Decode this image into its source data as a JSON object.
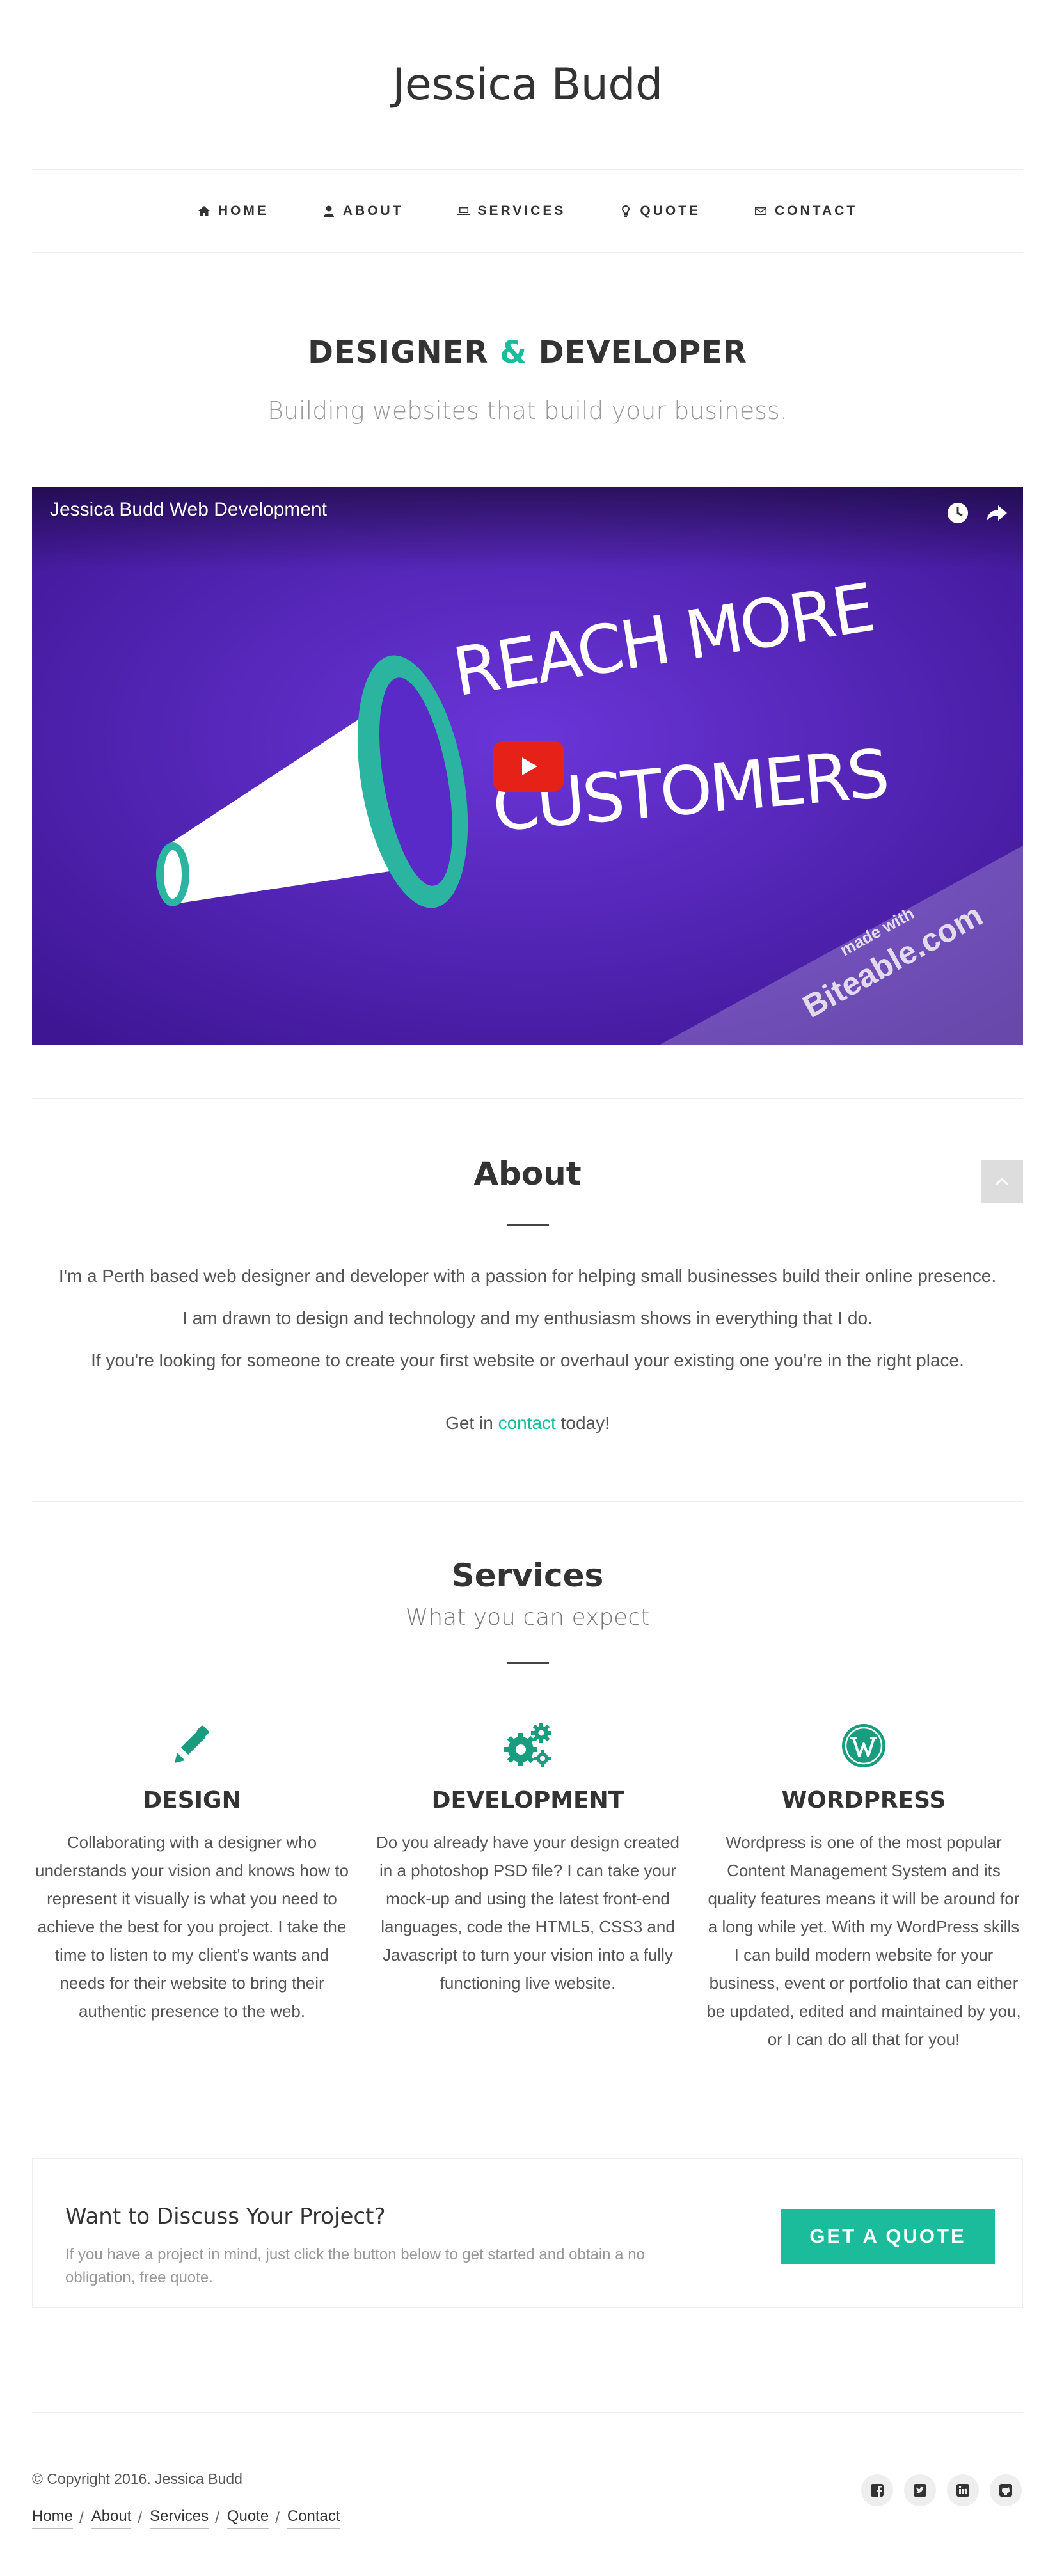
{
  "site": {
    "title": "Jessica Budd"
  },
  "nav": {
    "items": [
      {
        "label": "HOME",
        "icon": "home-icon"
      },
      {
        "label": "ABOUT",
        "icon": "user-icon"
      },
      {
        "label": "SERVICES",
        "icon": "laptop-icon"
      },
      {
        "label": "QUOTE",
        "icon": "lightbulb-icon"
      },
      {
        "label": "CONTACT",
        "icon": "envelope-icon"
      }
    ]
  },
  "hero": {
    "title_part1": "DESIGNER",
    "title_amp": "&",
    "title_part2": "DEVELOPER",
    "subtitle": "Building websites that build your business."
  },
  "video": {
    "title": "Jessica Budd Web Development",
    "art_line1": "REACH MORE",
    "art_line2": "CUSTOMERS",
    "watermark_small": "made with",
    "watermark": "Biteable.com",
    "background_color": "#4a1fa8",
    "play_color": "#e62117"
  },
  "about": {
    "title": "About",
    "p1": "I'm a Perth based web designer and developer with a passion for helping small businesses build their online presence.",
    "p2": "I am drawn to design and technology and my enthusiasm shows in everything that I do.",
    "p3": "If you're looking for someone to create your first website or overhaul your existing one you're in the right place.",
    "cta_before": "Get in ",
    "cta_link": "contact",
    "cta_after": " today!"
  },
  "services": {
    "title": "Services",
    "subtitle": "What you can expect",
    "items": [
      {
        "icon": "pencil-icon",
        "title": "DESIGN",
        "text": "Collaborating with a designer who understands your vision and knows how to represent it visually is what you need to achieve the best for you project. I take the time to listen to my client's wants and needs for their website to bring their authentic presence to the web."
      },
      {
        "icon": "gears-icon",
        "title": "DEVELOPMENT",
        "text": "Do you already have your design created in a photoshop PSD file? I can take your mock-up and using the latest front-end languages, code the HTML5, CSS3 and Javascript to turn your vision into a fully functioning live website."
      },
      {
        "icon": "wordpress-icon",
        "title": "WORDPRESS",
        "text": "Wordpress is one of the most popular Content Management System and its quality features means it will be around for a long while yet. With my WordPress skills I can build modern website for your business, event or portfolio that can either be updated, edited and maintained by you, or I can do all that for you!"
      }
    ]
  },
  "cta": {
    "title": "Want to Discuss Your Project?",
    "text": "If you have a project in mind, just click the button below to get started and obtain a no obligation, free quote.",
    "button": "GET A QUOTE"
  },
  "footer": {
    "copyright": "© Copyright 2016. Jessica Budd",
    "links": [
      "Home",
      "About",
      "Services",
      "Quote",
      "Contact"
    ],
    "separator": "/",
    "socials": [
      "facebook-icon",
      "twitter-icon",
      "linkedin-icon",
      "github-icon"
    ]
  },
  "colors": {
    "accent": "#1abc9c",
    "text": "#333333",
    "muted": "#999999"
  }
}
